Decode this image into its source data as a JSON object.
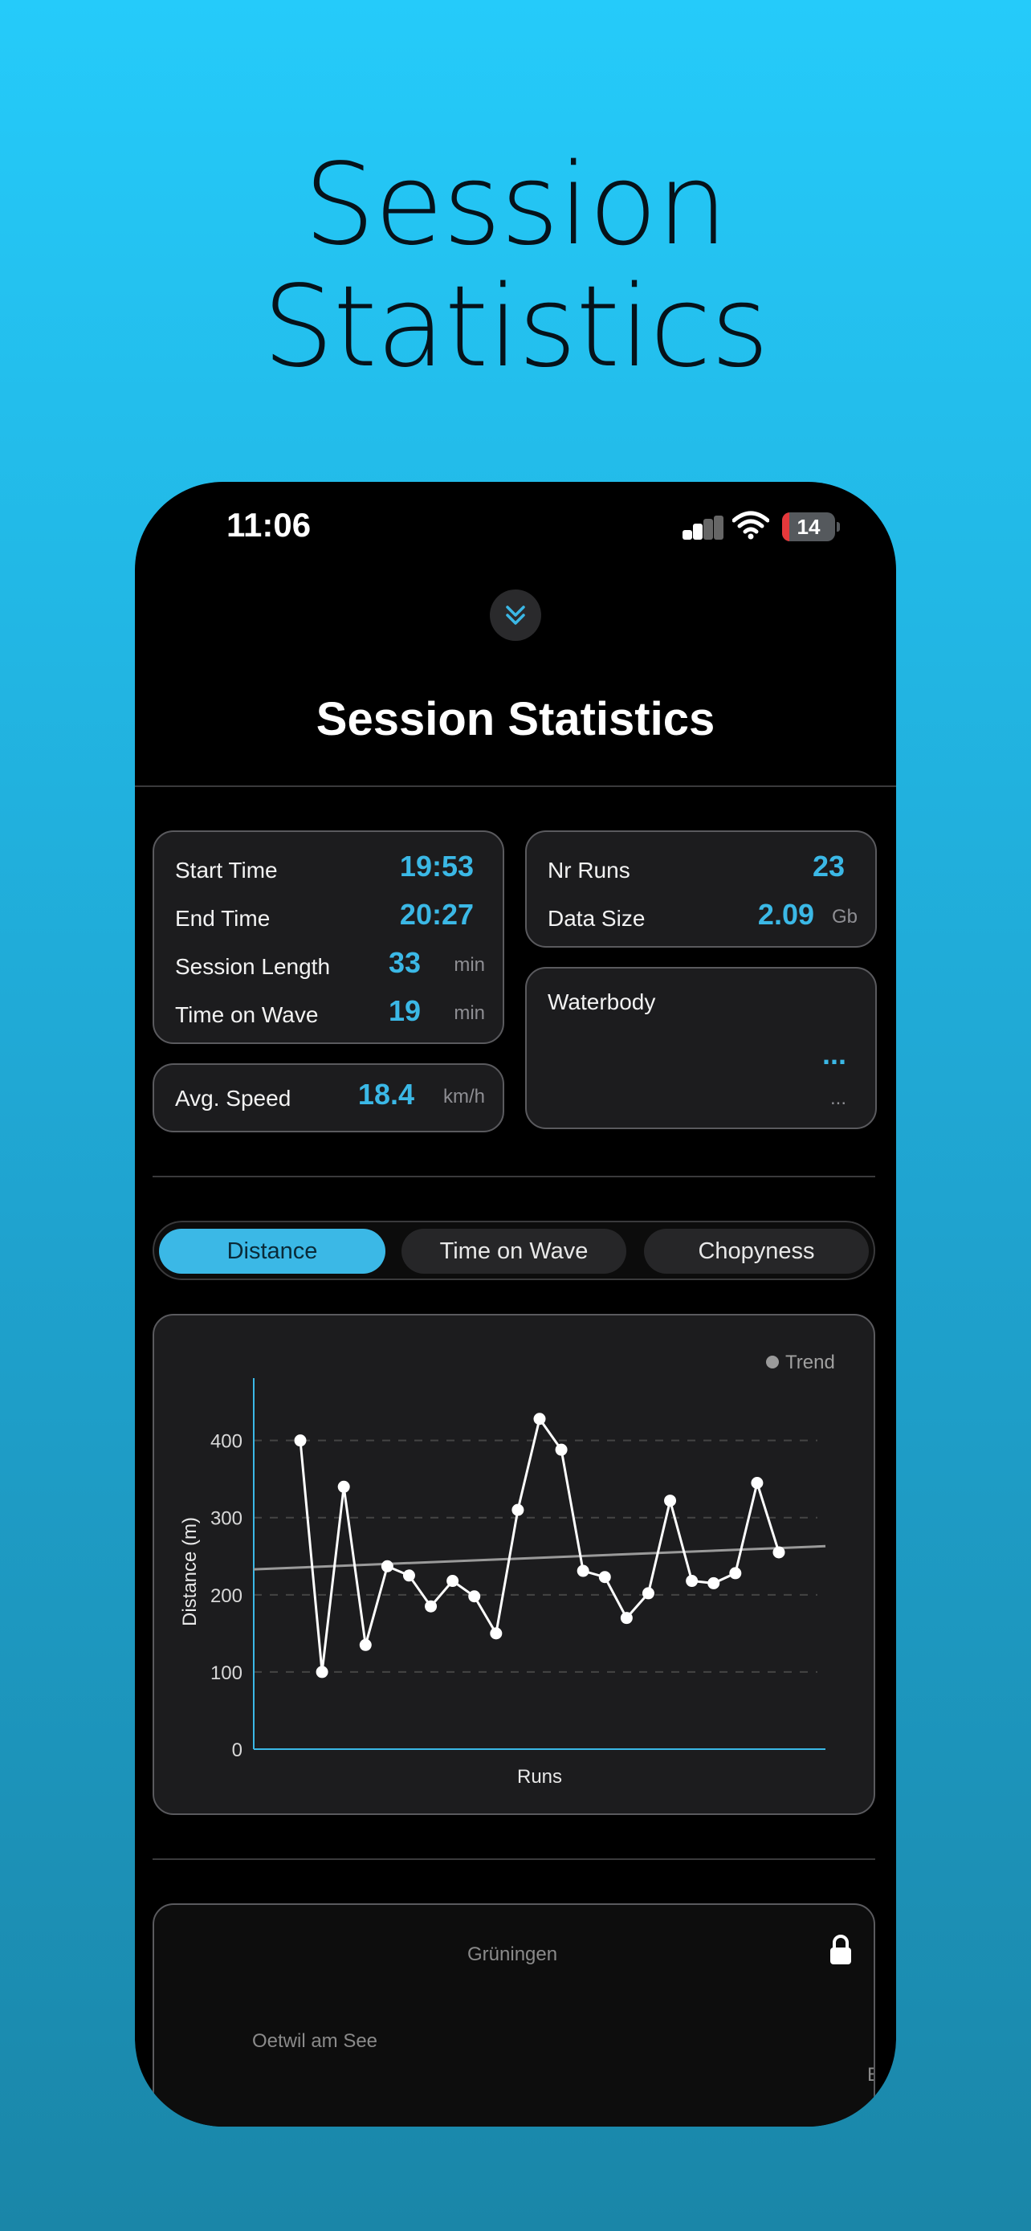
{
  "hero_title": [
    "Session",
    "Statistics"
  ],
  "status_bar": {
    "time": "11:06",
    "battery": "14"
  },
  "screen_title": "Session Statistics",
  "session": {
    "start_time": {
      "label": "Start Time",
      "value": "19:53"
    },
    "end_time": {
      "label": "End Time",
      "value": "20:27"
    },
    "session_length": {
      "label": "Session Length",
      "value": "33",
      "unit": "min"
    },
    "time_on_wave": {
      "label": "Time on Wave",
      "value": "19",
      "unit": "min"
    },
    "avg_speed": {
      "label": "Avg. Speed",
      "value": "18.4",
      "unit": "km/h"
    },
    "nr_runs": {
      "label": "Nr Runs",
      "value": "23"
    },
    "data_size": {
      "label": "Data Size",
      "value": "2.09",
      "unit": "Gb"
    },
    "waterbody": {
      "label": "Waterbody",
      "value": "...",
      "sub": "..."
    }
  },
  "tabs": [
    "Distance",
    "Time on Wave",
    "Chopyness"
  ],
  "active_tab": 0,
  "colors": {
    "accent": "#3bb8e6",
    "card": "#1c1c1e",
    "trend": "#9a9a9a",
    "line": "#ffffff"
  },
  "chart_data": {
    "type": "line",
    "xlabel": "Runs",
    "ylabel": "Distance (m)",
    "ylim": [
      0,
      460
    ],
    "yticks": [
      0,
      100,
      200,
      300,
      400
    ],
    "grid": "dashed-horizontal",
    "legend": {
      "position": "top-right",
      "entries": [
        "Trend"
      ]
    },
    "x": [
      1,
      2,
      3,
      4,
      5,
      6,
      7,
      8,
      9,
      10,
      11,
      12,
      13,
      14,
      15,
      16,
      17,
      18,
      19,
      20,
      21,
      22,
      23
    ],
    "series": [
      {
        "values": [
          400,
          100,
          340,
          135,
          237,
          225,
          185,
          218,
          198,
          150,
          310,
          428,
          388,
          231,
          223,
          170,
          202,
          322,
          218,
          215,
          228,
          345,
          255
        ]
      },
      {
        "name": "Trend",
        "values": [
          233,
          263
        ]
      }
    ]
  },
  "map": {
    "labels": [
      "Grüningen",
      "Oetwil am See",
      "E"
    ]
  }
}
